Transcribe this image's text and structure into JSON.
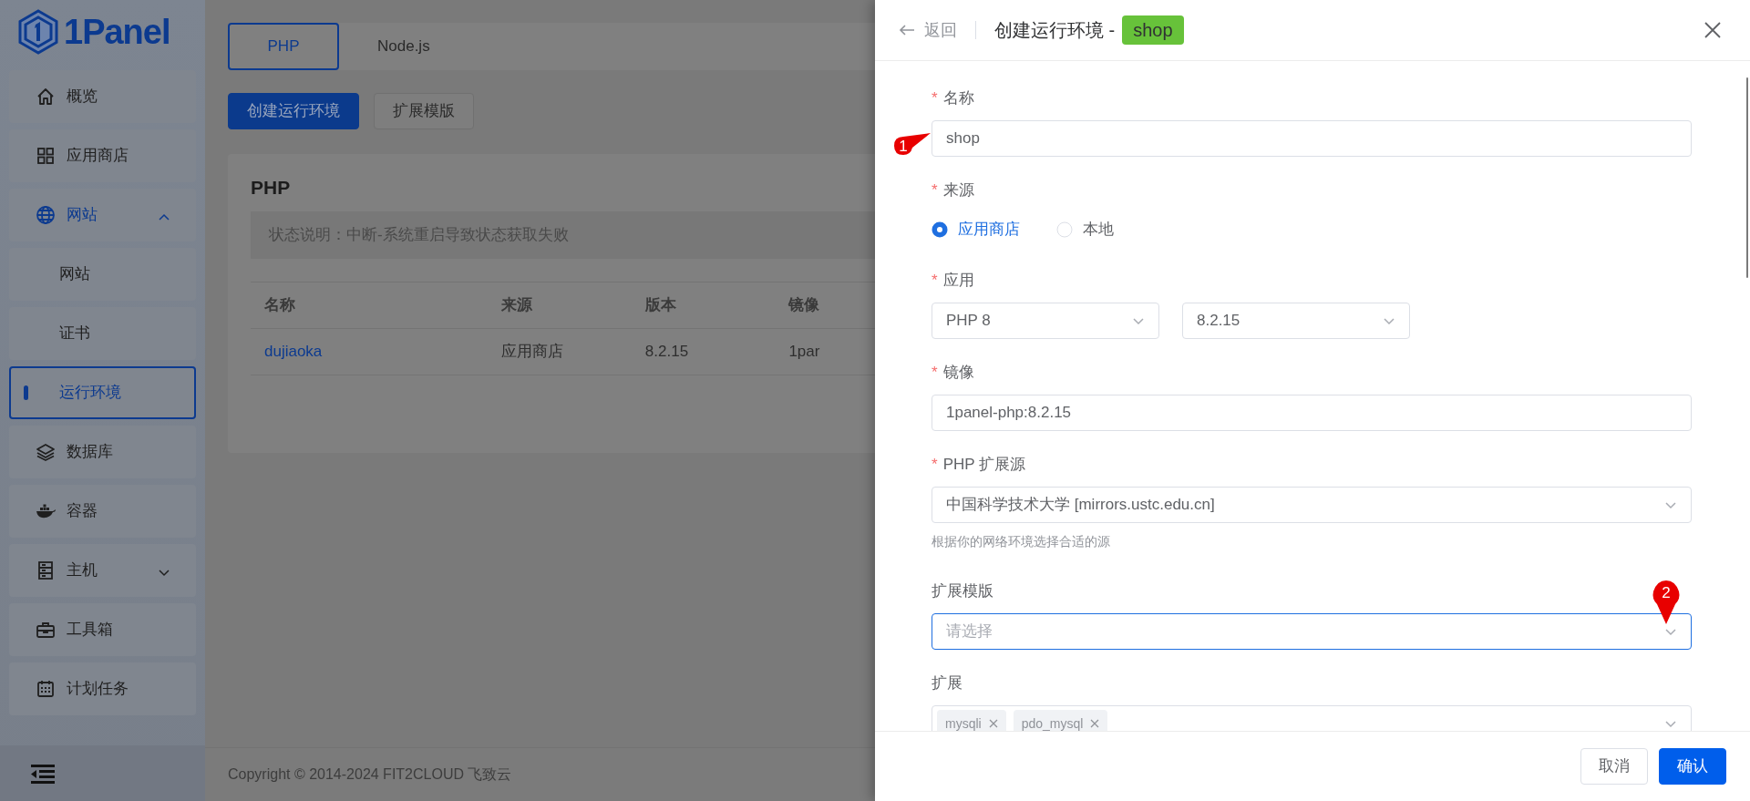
{
  "sidebar": {
    "logo_text": "1Panel",
    "items": [
      {
        "label": "概览",
        "selected": false
      },
      {
        "label": "应用商店",
        "selected": false
      },
      {
        "label": "网站",
        "selected": false,
        "expanded": true,
        "children": [
          {
            "label": "网站",
            "selected": false
          },
          {
            "label": "证书",
            "selected": false
          },
          {
            "label": "运行环境",
            "selected": true
          }
        ]
      },
      {
        "label": "数据库",
        "selected": false
      },
      {
        "label": "容器",
        "selected": false
      },
      {
        "label": "主机",
        "selected": false,
        "expanded": false
      },
      {
        "label": "工具箱",
        "selected": false
      },
      {
        "label": "计划任务",
        "selected": false
      }
    ]
  },
  "tabs": [
    {
      "label": "PHP",
      "selected": true
    },
    {
      "label": "Node.js",
      "selected": false
    }
  ],
  "toolbar": [
    {
      "label": "创建运行环境",
      "kind": "primary"
    },
    {
      "label": "扩展模版",
      "kind": "default"
    }
  ],
  "card": {
    "title": "PHP",
    "notice": "状态说明：中断-系统重启导致状态获取失败",
    "table": {
      "columns": [
        "名称",
        "来源",
        "版本",
        "镜像"
      ],
      "rows": [
        [
          "dujiaoka",
          "应用商店",
          "8.2.15",
          "1par"
        ]
      ]
    }
  },
  "footer": "Copyright © 2014-2024 FIT2CLOUD 飞致云",
  "drawer": {
    "back": "返回",
    "title": "创建运行环境 -",
    "title_tag": "shop",
    "fields": [
      {
        "kind": "input",
        "required": "*",
        "label": "名称",
        "value": "shop",
        "marker": "1"
      },
      {
        "kind": "radio",
        "required": "*",
        "label": "来源",
        "options": [
          {
            "label": "应用商店",
            "selected": true
          },
          {
            "label": "本地",
            "selected": false
          }
        ]
      },
      {
        "kind": "select_pair",
        "required": "*",
        "label": "应用",
        "values": [
          "PHP 8",
          "8.2.15"
        ]
      },
      {
        "kind": "input",
        "required": "*",
        "label": "镜像",
        "value": "1panel-php:8.2.15"
      },
      {
        "kind": "select",
        "required": "*",
        "label": "PHP 扩展源",
        "value": "中国科学技术大学 [mirrors.ustc.edu.cn]",
        "hint": "根据你的网络环境选择合适的源"
      },
      {
        "kind": "select",
        "label": "扩展模版",
        "placeholder": "请选择",
        "focused": true,
        "marker": "2"
      },
      {
        "kind": "tags",
        "label": "扩展",
        "tags": [
          "mysqli",
          "pdo_mysql"
        ]
      }
    ],
    "buttons": [
      {
        "label": "取消",
        "kind": "default"
      },
      {
        "label": "确认",
        "kind": "primary"
      }
    ]
  }
}
